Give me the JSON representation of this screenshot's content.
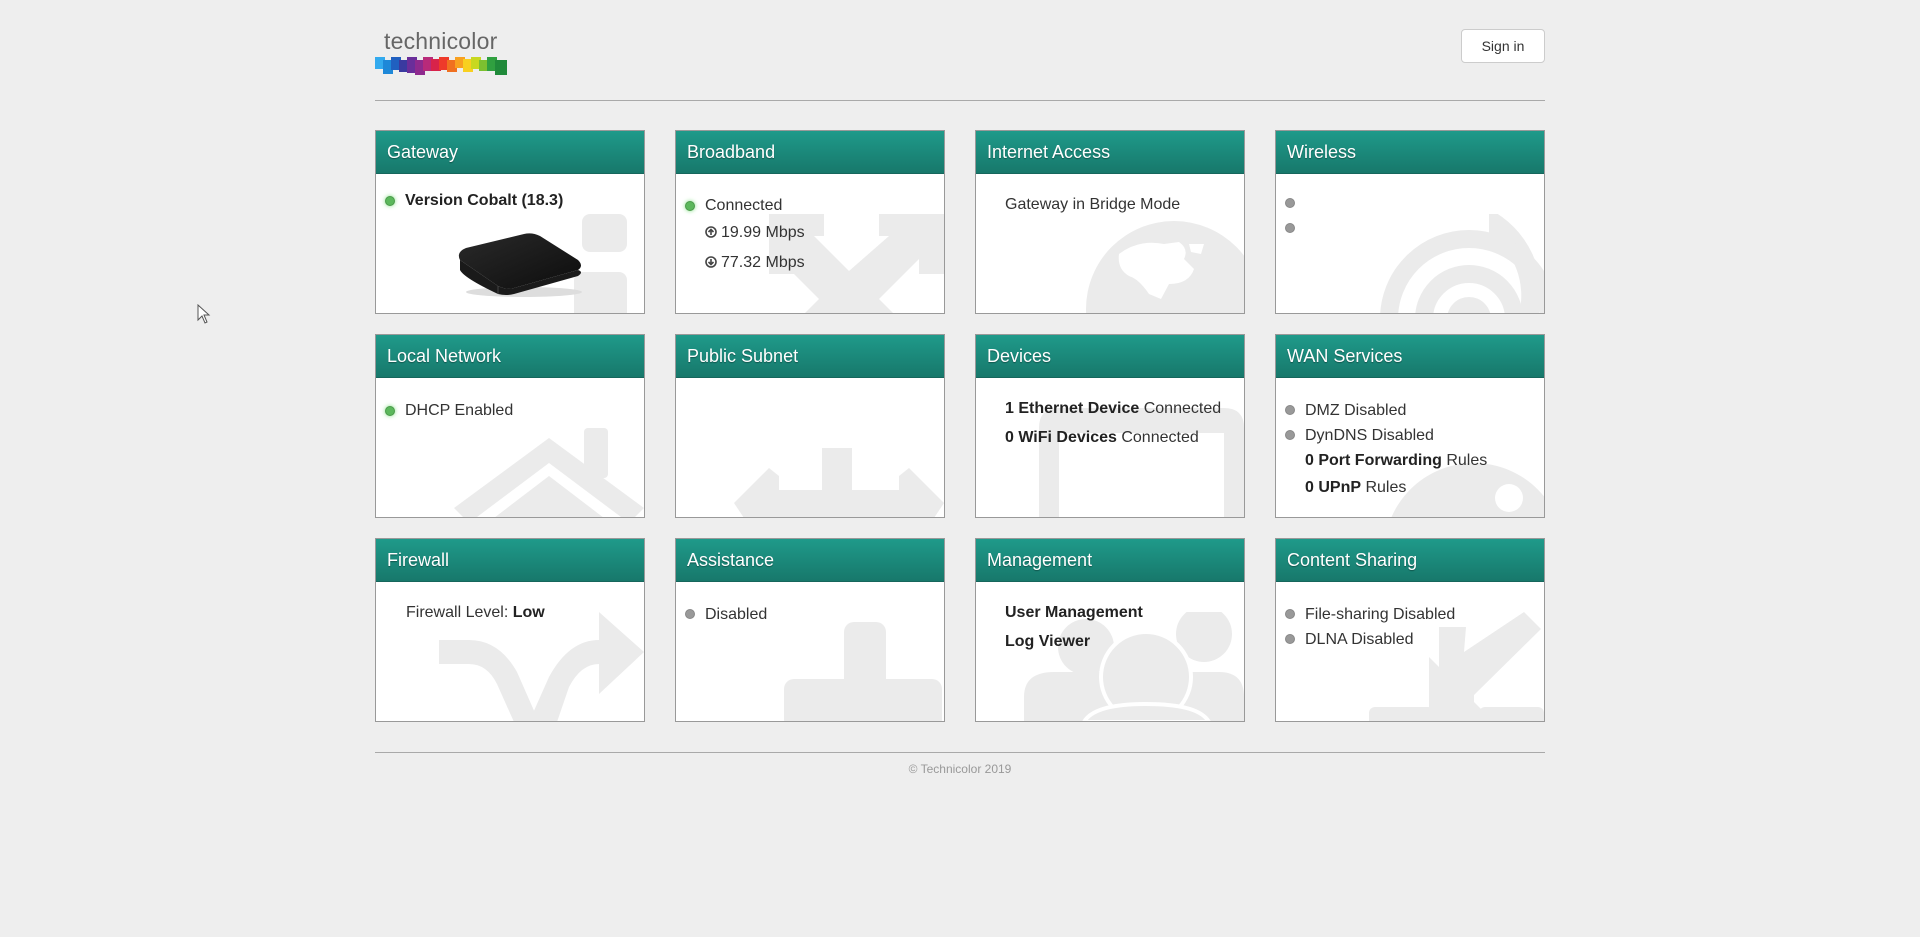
{
  "header": {
    "logo_text": "technicolor",
    "signin_label": "Sign in"
  },
  "colors": {
    "card_header_top": "#1f9a8a",
    "card_header_bottom": "#17786b",
    "status_green": "#5cb85c",
    "status_grey": "#999999",
    "page_background": "#eeeeee"
  },
  "cards": {
    "gateway": {
      "title": "Gateway",
      "status": "green",
      "version": "Version Cobalt (18.3)"
    },
    "broadband": {
      "title": "Broadband",
      "status": "green",
      "state": "Connected",
      "upload": "19.99 Mbps",
      "download": "77.32 Mbps"
    },
    "internet": {
      "title": "Internet Access",
      "text": "Gateway in Bridge Mode"
    },
    "wireless": {
      "title": "Wireless",
      "items": [
        {
          "status": "grey",
          "text": ""
        },
        {
          "status": "grey",
          "text": ""
        }
      ]
    },
    "local": {
      "title": "Local Network",
      "status": "green",
      "text": "DHCP Enabled"
    },
    "subnet": {
      "title": "Public Subnet"
    },
    "devices": {
      "title": "Devices",
      "ethernet_count": "1 Ethernet Device",
      "ethernet_suffix": " Connected",
      "wifi_count": "0 WiFi Devices",
      "wifi_suffix": " Connected"
    },
    "wan": {
      "title": "WAN Services",
      "dmz": "DMZ Disabled",
      "dyndns": "DynDNS Disabled",
      "pf_count": "0 Port Forwarding",
      "pf_suffix": " Rules",
      "upnp_count": "0 UPnP",
      "upnp_suffix": " Rules"
    },
    "firewall": {
      "title": "Firewall",
      "label": "Firewall Level: ",
      "level": "Low"
    },
    "assistance": {
      "title": "Assistance",
      "status": "grey",
      "text": "Disabled"
    },
    "management": {
      "title": "Management",
      "links": [
        "User Management",
        "Log Viewer"
      ]
    },
    "content": {
      "title": "Content Sharing",
      "file_sharing": "File-sharing Disabled",
      "dlna": "DLNA Disabled"
    }
  },
  "footer": {
    "copyright": "© Technicolor 2019"
  }
}
